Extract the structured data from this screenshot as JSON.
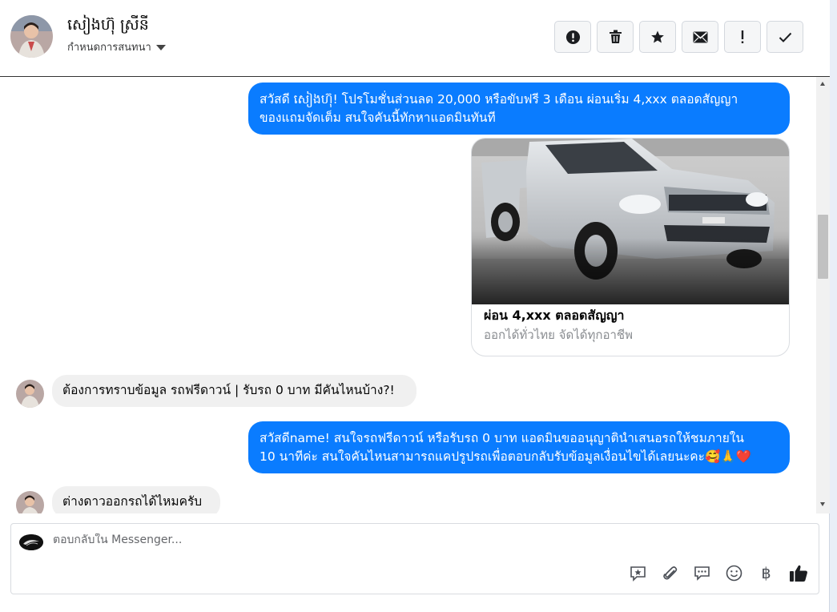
{
  "header": {
    "contact_name": "សៀងហ៊ុ ស្រីនី",
    "settings_label": "กำหนดการสนทนา",
    "actions": [
      {
        "name": "report-button",
        "icon": "alert-circle-icon"
      },
      {
        "name": "delete-button",
        "icon": "trash-icon"
      },
      {
        "name": "star-button",
        "icon": "star-icon"
      },
      {
        "name": "mail-button",
        "icon": "envelope-icon"
      },
      {
        "name": "important-button",
        "icon": "exclamation-icon"
      },
      {
        "name": "done-button",
        "icon": "checkmark-icon"
      }
    ]
  },
  "messages": {
    "out1": {
      "line1": "สวัสดี សៀងហ៊ុ! โปรโมชั่นส่วนลด 20,000 หรือขับฟรี 3 เดือน ผ่อนเริ่ม 4,xxx ตลอดสัญญา",
      "line2": "ของแถมจัดเต็ม สนใจคันนี้ทักหาแอดมินทันที"
    },
    "card": {
      "title": "ผ่อน 4,xxx ตลอดสัญญา",
      "subtitle": "ออกได้ทั่วไทย จัดได้ทุกอาชีพ"
    },
    "in1": "ต้องการทราบข้อมูล รถฟรีดาวน์ | รับรถ 0 บาท มีคันไหนบ้าง?!",
    "out2": {
      "line1": "สวัสดีname! สนใจรถฟรีดาวน์ หรือรับรถ 0 บาท แอดมินขออนุญาตินำเสนอรถให้ชมภายใน",
      "line2": "10 นาทีค่ะ สนใจคันไหนสามารถแคปรูปรถเพื่อตอบกลับรับข้อมูลเงื่อนไขได้เลยนะคะ🥰🙏❤️"
    },
    "in2": "ต่างดาวออกรถได้ไหมครับ"
  },
  "composer": {
    "placeholder": "ตอบกลับใน Messenger...",
    "tools": [
      "sticker-icon",
      "paperclip-icon",
      "chat-bubble-icon",
      "emoji-icon",
      "baht-icon",
      "thumbs-up-icon"
    ],
    "baht_symbol": "฿"
  },
  "colors": {
    "outgoing_bubble": "#0a7cff",
    "incoming_bubble": "#f0f0f0"
  }
}
